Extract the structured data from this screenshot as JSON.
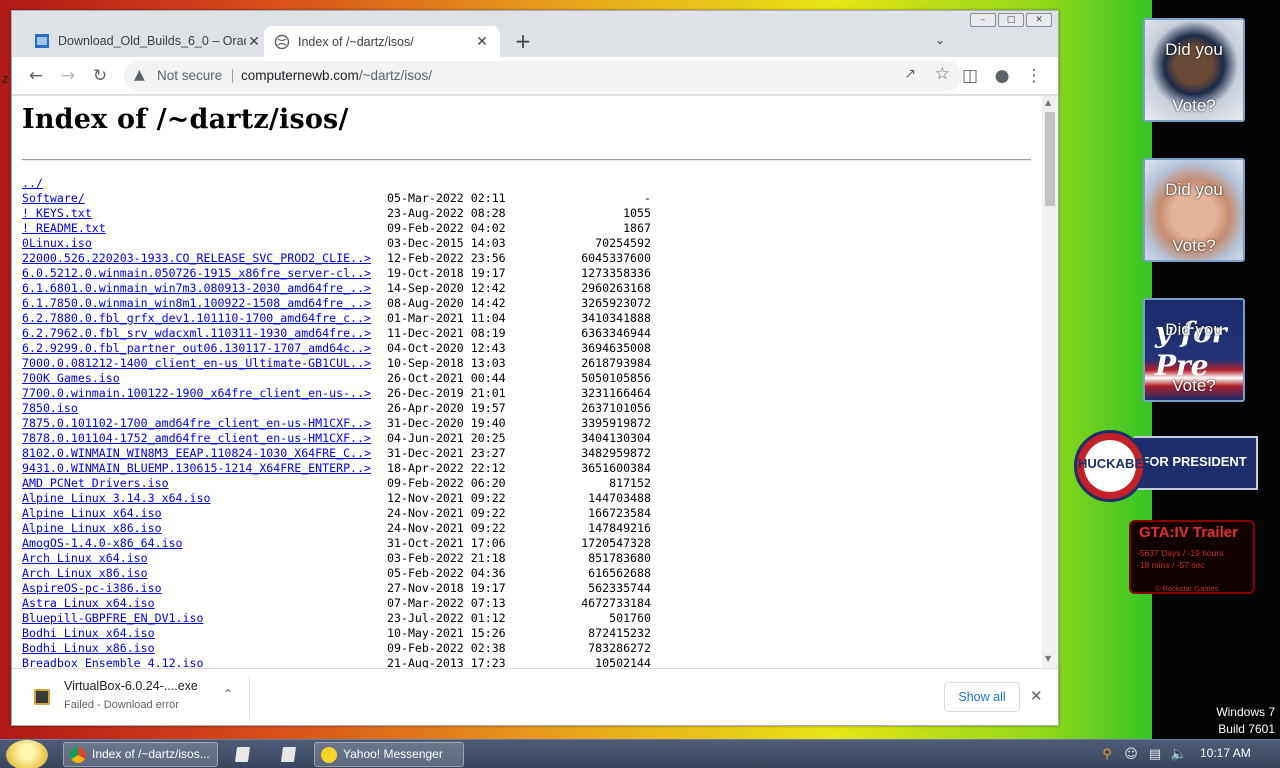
{
  "browser": {
    "tabs": [
      {
        "title": "Download_Old_Builds_6_0 – Orac",
        "close": "✕"
      },
      {
        "title": "Index of /~dartz/isos/",
        "close": "✕"
      }
    ],
    "new_tab": "+",
    "tab_search": "⌄",
    "not_secure": "Not secure",
    "url_host": "computernewb.com",
    "url_path": "/~dartz/isos/",
    "window_controls": [
      "–",
      "□",
      "✕"
    ]
  },
  "page": {
    "title": "Index of /~dartz/isos/",
    "entries": [
      {
        "name": "../",
        "date": "",
        "size": ""
      },
      {
        "name": "Software/",
        "date": "05-Mar-2022 02:11",
        "size": "-"
      },
      {
        "name": "! KEYS.txt",
        "date": "23-Aug-2022 08:28",
        "size": "1055"
      },
      {
        "name": "! README.txt",
        "date": "09-Feb-2022 04:02",
        "size": "1867"
      },
      {
        "name": "0Linux.iso",
        "date": "03-Dec-2015 14:03",
        "size": "70254592"
      },
      {
        "name": "22000.526.220203-1933.CO_RELEASE_SVC_PROD2_CLIE..>",
        "date": "12-Feb-2022 23:56",
        "size": "6045337600"
      },
      {
        "name": "6.0.5212.0.winmain.050726-1915_x86fre_server-cl..>",
        "date": "19-Oct-2018 19:17",
        "size": "1273358336"
      },
      {
        "name": "6.1.6801.0.winmain_win7m3.080913-2030_amd64fre_..>",
        "date": "14-Sep-2020 12:42",
        "size": "2960263168"
      },
      {
        "name": "6.1.7850.0.winmain_win8m1.100922-1508_amd64fre_..>",
        "date": "08-Aug-2020 14:42",
        "size": "3265923072"
      },
      {
        "name": "6.2.7880.0.fbl_grfx_dev1.101110-1700_amd64fre_c..>",
        "date": "01-Mar-2021 11:04",
        "size": "3410341888"
      },
      {
        "name": "6.2.7962.0.fbl_srv_wdacxml.110311-1930_amd64fre..>",
        "date": "11-Dec-2021 08:19",
        "size": "6363346944"
      },
      {
        "name": "6.2.9299.0.fbl_partner_out06.130117-1707_amd64c..>",
        "date": "04-Oct-2020 12:43",
        "size": "3694635008"
      },
      {
        "name": "7000.0.081212-1400_client_en-us_Ultimate-GB1CUL..>",
        "date": "10-Sep-2018 13:03",
        "size": "2618793984"
      },
      {
        "name": "700K Games.iso",
        "date": "26-Oct-2021 00:44",
        "size": "5050105856"
      },
      {
        "name": "7700.0.winmain.100122-1900_x64fre_client_en-us-..>",
        "date": "26-Dec-2019 21:01",
        "size": "3231166464"
      },
      {
        "name": "7850.iso",
        "date": "26-Apr-2020 19:57",
        "size": "2637101056"
      },
      {
        "name": "7875.0.101102-1700_amd64fre_client_en-us-HM1CXF..>",
        "date": "31-Dec-2020 19:40",
        "size": "3395919872"
      },
      {
        "name": "7878.0.101104-1752_amd64fre_client_en-us-HM1CXF..>",
        "date": "04-Jun-2021 20:25",
        "size": "3404130304"
      },
      {
        "name": "8102.0.WINMAIN_WIN8M3_EEAP.110824-1030_X64FRE_C..>",
        "date": "31-Dec-2021 23:27",
        "size": "3482959872"
      },
      {
        "name": "9431.0.WINMAIN_BLUEMP.130615-1214_X64FRE_ENTERP..>",
        "date": "18-Apr-2022 22:12",
        "size": "3651600384"
      },
      {
        "name": "AMD PCNet Drivers.iso",
        "date": "09-Feb-2022 06:20",
        "size": "817152"
      },
      {
        "name": "Alpine Linux 3.14.3 x64.iso",
        "date": "12-Nov-2021 09:22",
        "size": "144703488"
      },
      {
        "name": "Alpine Linux x64.iso",
        "date": "24-Nov-2021 09:22",
        "size": "166723584"
      },
      {
        "name": "Alpine Linux x86.iso",
        "date": "24-Nov-2021 09:22",
        "size": "147849216"
      },
      {
        "name": "AmogOS-1.4.0-x86_64.iso",
        "date": "31-Oct-2021 17:06",
        "size": "1720547328"
      },
      {
        "name": "Arch Linux x64.iso",
        "date": "03-Feb-2022 21:18",
        "size": "851783680"
      },
      {
        "name": "Arch Linux x86.iso",
        "date": "05-Feb-2022 04:36",
        "size": "616562688"
      },
      {
        "name": "AspireOS-pc-i386.iso",
        "date": "27-Nov-2018 19:17",
        "size": "562335744"
      },
      {
        "name": "Astra Linux x64.iso",
        "date": "07-Mar-2022 07:13",
        "size": "4672733184"
      },
      {
        "name": "Bluepill-GBPFRE_EN_DV1.iso",
        "date": "23-Jul-2022 01:12",
        "size": "501760"
      },
      {
        "name": "Bodhi Linux x64.iso",
        "date": "10-May-2021 15:26",
        "size": "872415232"
      },
      {
        "name": "Bodhi Linux x86.iso",
        "date": "09-Feb-2022 02:38",
        "size": "783286272"
      },
      {
        "name": "Breadbox Ensemble 4.12.iso",
        "date": "21-Aug-2013 17:23",
        "size": "10502144"
      }
    ]
  },
  "downloads": {
    "file_name": "VirtualBox-6.0.24-....exe",
    "status": "Failed - Download error",
    "show_all": "Show all"
  },
  "gadgets": {
    "vote_line1": "Did you",
    "vote_line2": "Vote?",
    "vote3_overlay": "y for Pre",
    "huckabee_name": "HUCKABEE",
    "huckabee_for": "FOR PRESIDENT",
    "gta_title": "GTA:IV Trailer",
    "gta_countdown_1": "-5637 Days / -19 hours",
    "gta_countdown_2": "-18 mins / -57 sec",
    "gta_credit": "© Rockstar Games"
  },
  "watermark": {
    "line1": "Windows 7",
    "line2": "Build 7601"
  },
  "taskbar": {
    "chrome_task": "Index of /~dartz/isos...",
    "yahoo_task": "Yahoo! Messenger",
    "clock": "10:17 AM"
  },
  "stray_text": "z"
}
